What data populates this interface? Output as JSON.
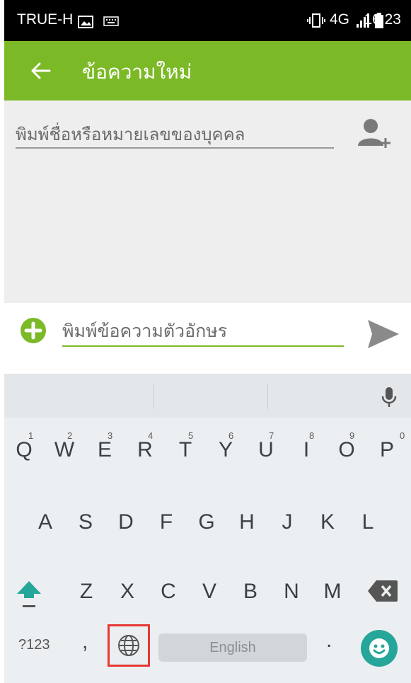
{
  "status_bar": {
    "carrier": "TRUE-H",
    "network": "4G",
    "network_sup": "4G",
    "time": "16:23"
  },
  "app_bar": {
    "title": "ข้อความใหม่",
    "back_icon": "arrow-left-icon"
  },
  "recipient": {
    "placeholder": "พิมพ์ชื่อหรือหมายเลขของบุคคล",
    "add_contact_icon": "person-add-icon"
  },
  "compose": {
    "placeholder": "พิมพ์ข้อความตัวอักษร",
    "attach_icon": "plus-circle-icon",
    "send_icon": "send-arrow-icon"
  },
  "keyboard": {
    "row1": [
      "Q",
      "W",
      "E",
      "R",
      "T",
      "Y",
      "U",
      "I",
      "O",
      "P"
    ],
    "row1_hints": [
      "1",
      "2",
      "3",
      "4",
      "5",
      "6",
      "7",
      "8",
      "9",
      "0"
    ],
    "row2": [
      "A",
      "S",
      "D",
      "F",
      "G",
      "H",
      "J",
      "K",
      "L"
    ],
    "row3": [
      "Z",
      "X",
      "C",
      "V",
      "B",
      "N",
      "M"
    ],
    "symbols_label": "?123",
    "comma": ",",
    "period": ".",
    "spacebar_label": "English",
    "globe_icon": "globe-icon",
    "mic_icon": "microphone-icon",
    "shift_icon": "shift-arrow-icon",
    "backspace_icon": "backspace-icon",
    "emoji_icon": "smiley-icon",
    "accent_color": "#26a69a",
    "highlight_color": "#e53935"
  },
  "colors": {
    "app_bar": "#7cb927",
    "status_bar": "#000000"
  }
}
